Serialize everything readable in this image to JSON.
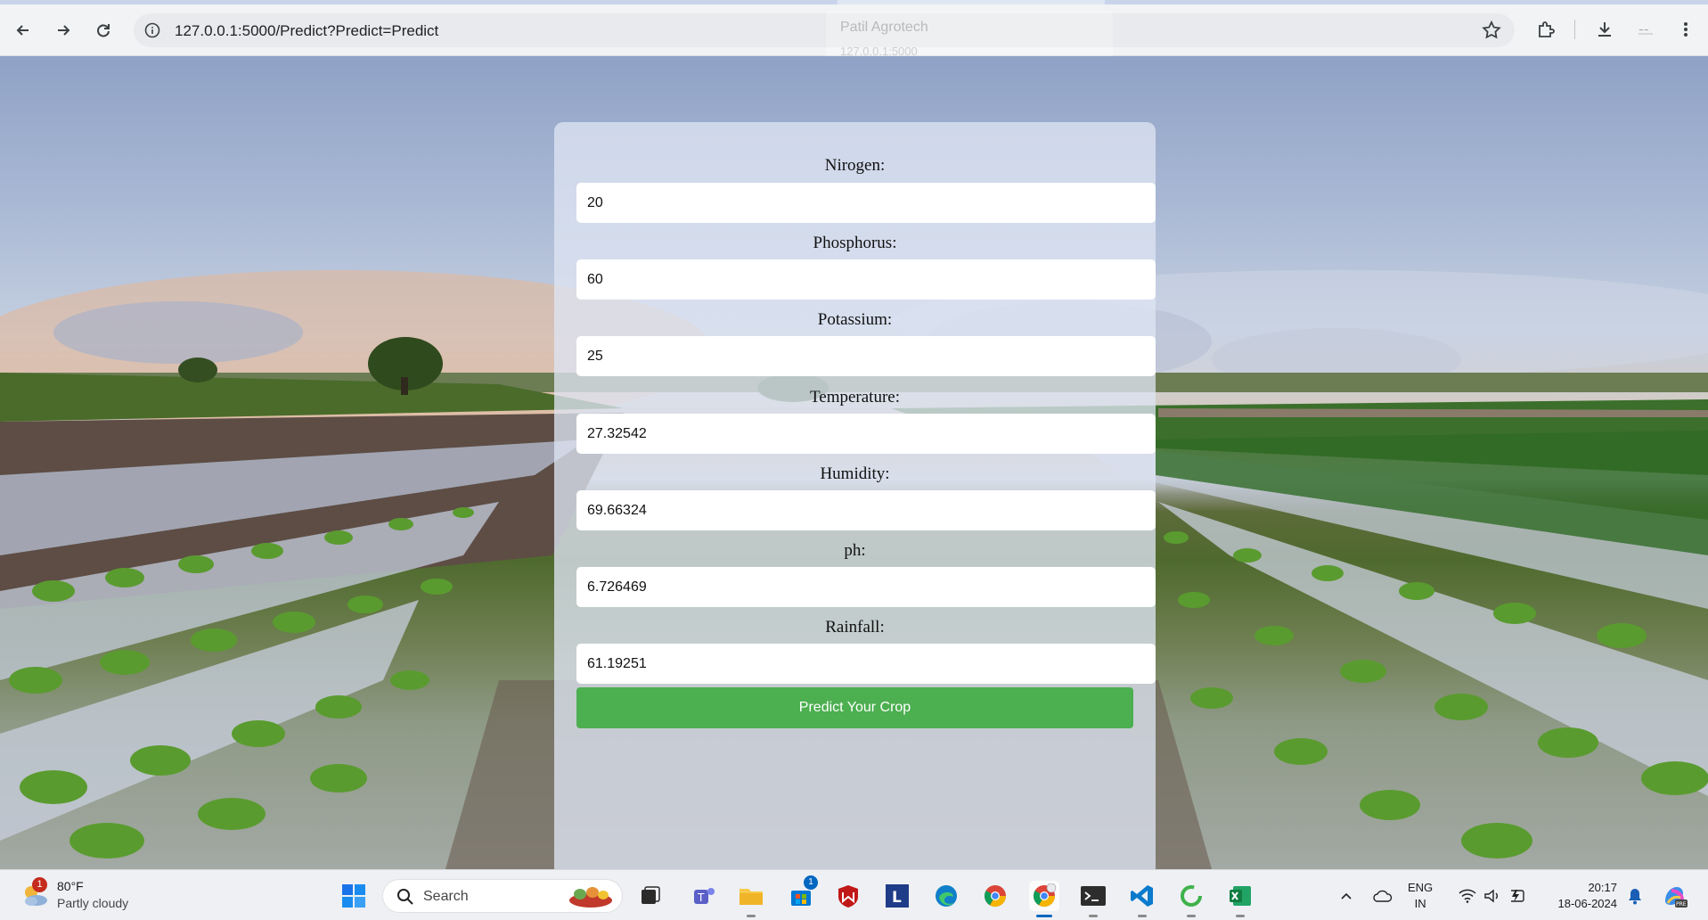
{
  "browser": {
    "url": "127.0.0.1:5000/Predict?Predict=Predict",
    "ghost_tab_title": "Patil Agrotech",
    "ghost_tab_url": "127.0.0.1:5000"
  },
  "form": {
    "fields": [
      {
        "label": "Nirogen:",
        "value": "20"
      },
      {
        "label": "Phosphorus:",
        "value": "60"
      },
      {
        "label": "Potassium:",
        "value": "25"
      },
      {
        "label": "Temperature:",
        "value": "27.32542"
      },
      {
        "label": "Humidity:",
        "value": "69.66324"
      },
      {
        "label": "ph:",
        "value": "6.726469"
      },
      {
        "label": "Rainfall:",
        "value": "61.19251"
      }
    ],
    "submit_label": "Predict Your Crop",
    "button_color": "#4caf50"
  },
  "taskbar": {
    "weather_temp": "80°F",
    "weather_condition": "Partly cloudy",
    "weather_badge": "1",
    "search_label": "Search",
    "store_badge": "1",
    "apps": [
      "widgets",
      "start",
      "search",
      "task-view",
      "teams",
      "file-explorer",
      "microsoft-store",
      "mcafee",
      "l-app",
      "edge",
      "chrome",
      "chrome-active",
      "terminal",
      "vscode",
      "loader-app",
      "excel"
    ],
    "language": "ENG",
    "region": "IN",
    "time": "20:17",
    "date": "18-06-2024"
  }
}
